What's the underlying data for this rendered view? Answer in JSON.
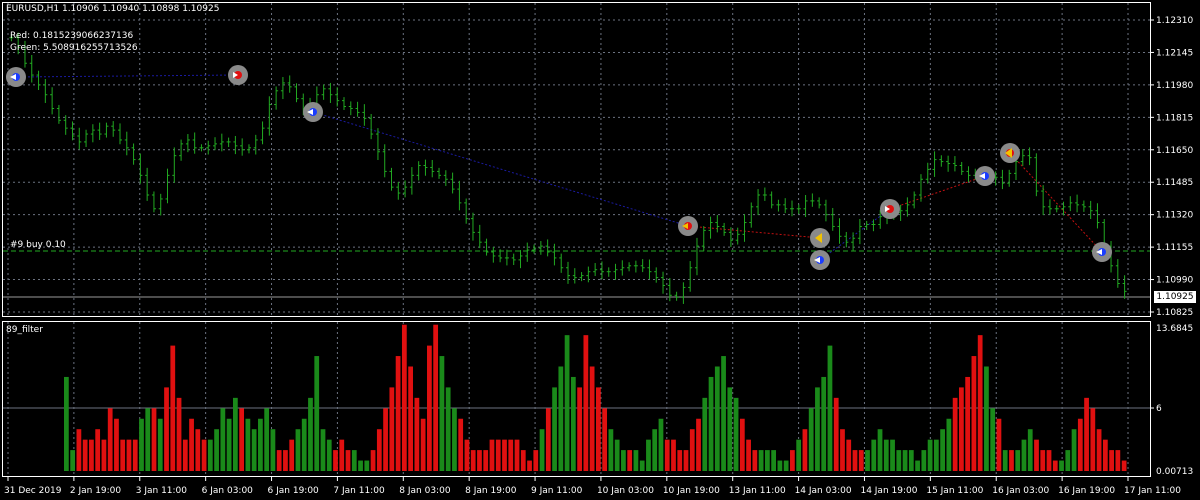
{
  "header": {
    "symbol_line": "EURUSD,H1  1.10906 1.10940 1.10898 1.10925",
    "red_value": "Red: 0.1815239066237136",
    "green_value": "Green: 5.508916255713526"
  },
  "order_line": {
    "label": "#9 buy 0.10"
  },
  "current_price": "1.10925",
  "indicator": {
    "name": "89_filter",
    "max_label": "13.6845",
    "mid_label": "6",
    "min_label": "0.00713"
  },
  "price_axis": {
    "labels": [
      "1.12310",
      "1.12145",
      "1.11980",
      "1.11815",
      "1.11650",
      "1.11485",
      "1.11320",
      "1.11155",
      "1.10990",
      "1.10825"
    ]
  },
  "time_axis": {
    "labels": [
      "31 Dec 2019",
      "2 Jan 19:00",
      "3 Jan 11:00",
      "6 Jan 03:00",
      "6 Jan 19:00",
      "7 Jan 11:00",
      "8 Jan 03:00",
      "8 Jan 19:00",
      "9 Jan 11:00",
      "10 Jan 03:00",
      "10 Jan 19:00",
      "13 Jan 11:00",
      "14 Jan 03:00",
      "14 Jan 19:00",
      "15 Jan 11:00",
      "16 Jan 03:00",
      "16 Jan 19:00",
      "17 Jan 11:00"
    ]
  },
  "colors": {
    "background": "#000000",
    "candle": "#22aa22",
    "grid": "#6b7280",
    "hist_green": "#1a8a1a",
    "hist_red": "#e01010",
    "trend_line": "#1a1aa0",
    "trade_line": "#c01010"
  },
  "chart_data": {
    "type": "line",
    "series": [
      {
        "values": [
          1.1222,
          1.1217,
          1.1209,
          1.1203,
          1.1198,
          1.1193,
          1.1186,
          1.118,
          1.1176,
          1.1172,
          1.1169,
          1.1173,
          1.1175,
          1.1173,
          1.1177,
          1.1175,
          1.117,
          1.1166,
          1.116,
          1.1152,
          1.1142,
          1.1135,
          1.114,
          1.1152,
          1.1162,
          1.1168,
          1.117,
          1.1166,
          1.1166,
          1.1167,
          1.1168,
          1.1169,
          1.1169,
          1.1167,
          1.1165,
          1.1166,
          1.117,
          1.1176,
          1.1188,
          1.1195,
          1.1199,
          1.1197,
          1.1191,
          1.1186,
          1.1188,
          1.1193,
          1.1196,
          1.1193,
          1.119,
          1.1187,
          1.1186,
          1.1184,
          1.1181,
          1.1173,
          1.1164,
          1.1154,
          1.1146,
          1.1143,
          1.1146,
          1.1152,
          1.1157,
          1.1156,
          1.1154,
          1.1152,
          1.115,
          1.1145,
          1.1138,
          1.113,
          1.1123,
          1.1118,
          1.1113,
          1.1111,
          1.111,
          1.111,
          1.1109,
          1.1111,
          1.1114,
          1.1115,
          1.1116,
          1.1113,
          1.111,
          1.1105,
          1.1101,
          1.11,
          1.1101,
          1.1103,
          1.1104,
          1.1103,
          1.1103,
          1.1104,
          1.1105,
          1.1106,
          1.1106,
          1.1105,
          1.1103,
          1.11,
          1.1096,
          1.1091,
          1.109,
          1.1095,
          1.1105,
          1.1116,
          1.1124,
          1.1128,
          1.1126,
          1.1123,
          1.1119,
          1.1122,
          1.1128,
          1.1136,
          1.1142,
          1.1142,
          1.1137,
          1.1137,
          1.1135,
          1.1135,
          1.1135,
          1.1139,
          1.1139,
          1.1137,
          1.1132,
          1.1126,
          1.1121,
          1.1118,
          1.112,
          1.1126,
          1.1127,
          1.1127,
          1.1131,
          1.1132,
          1.1133,
          1.1134,
          1.1137,
          1.1142,
          1.115,
          1.1155,
          1.116,
          1.1159,
          1.1158,
          1.1157,
          1.1154,
          1.1152,
          1.1152,
          1.1152,
          1.1151,
          1.1151,
          1.1148,
          1.1153,
          1.1159,
          1.1162,
          1.1161,
          1.1144,
          1.1136,
          1.1135,
          1.1135,
          1.1136,
          1.1138,
          1.1137,
          1.1136,
          1.1134,
          1.1128,
          1.1116,
          1.1106,
          1.1097,
          1.1093
        ]
      },
      {
        "name": "89_filter",
        "values": [
          9,
          2,
          4,
          3,
          3,
          4,
          3,
          6,
          5,
          3,
          3,
          3,
          5,
          6,
          6,
          5,
          8,
          12,
          7,
          3,
          5,
          4,
          3,
          3,
          4,
          6,
          5,
          7,
          6,
          5,
          4,
          5,
          6,
          4,
          2,
          2,
          3,
          4,
          5,
          7,
          11,
          4,
          3,
          2,
          3,
          2,
          2,
          1,
          1,
          2,
          4,
          6,
          8,
          11,
          14,
          10,
          7,
          5,
          12,
          14,
          11,
          8,
          6,
          5,
          3,
          2,
          2,
          2,
          3,
          3,
          3,
          3,
          3,
          2,
          1,
          2,
          4,
          6,
          8,
          10,
          13,
          9,
          8,
          13,
          10,
          8,
          6,
          4,
          3,
          2,
          2,
          2,
          1,
          3,
          4,
          5,
          3,
          3,
          2,
          2,
          4,
          5,
          7,
          9,
          10,
          11,
          8,
          7,
          5,
          3,
          2,
          2,
          2,
          2,
          1,
          1,
          2,
          3,
          4,
          6,
          8,
          9,
          12,
          7,
          4,
          3,
          2,
          2,
          2,
          3,
          4,
          3,
          3,
          2,
          2,
          2,
          1,
          2,
          3,
          3,
          4,
          5,
          7,
          8,
          9,
          11,
          13,
          10,
          6,
          5,
          2,
          2,
          2,
          3,
          4,
          3,
          2,
          2,
          1,
          1,
          2,
          4,
          5,
          7,
          6,
          4,
          3,
          2,
          2,
          1
        ]
      }
    ],
    "xlim_labels": [
      "31 Dec 2019",
      "17 Jan 11:00"
    ],
    "ylim": [
      1.10825,
      1.1231
    ]
  }
}
